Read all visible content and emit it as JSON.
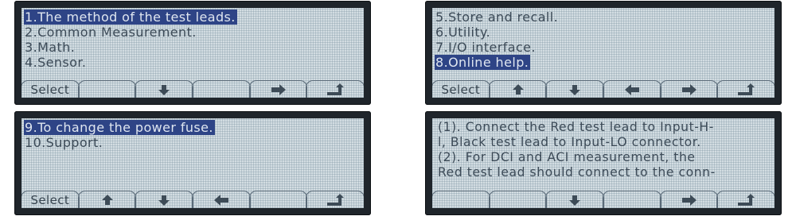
{
  "panels": [
    {
      "lines": [
        {
          "text": "1.The method of the test leads.",
          "selected": true
        },
        {
          "text": "2.Common Measurement.",
          "selected": false
        },
        {
          "text": "3.Math.",
          "selected": false
        },
        {
          "text": "4.Sensor.",
          "selected": false
        }
      ],
      "softkeys": [
        {
          "label": "Select",
          "icon": ""
        },
        {
          "label": "",
          "icon": ""
        },
        {
          "label": "",
          "icon": "down-arrow-icon"
        },
        {
          "label": "",
          "icon": ""
        },
        {
          "label": "",
          "icon": "right-arrow-icon"
        },
        {
          "label": "",
          "icon": "return-icon"
        }
      ]
    },
    {
      "lines": [
        {
          "text": "5.Store and recall.",
          "selected": false
        },
        {
          "text": "6.Utility.",
          "selected": false
        },
        {
          "text": "7.I/O interface.",
          "selected": false
        },
        {
          "text": "8.Online help.",
          "selected": true
        }
      ],
      "softkeys": [
        {
          "label": "Select",
          "icon": ""
        },
        {
          "label": "",
          "icon": "up-arrow-icon"
        },
        {
          "label": "",
          "icon": "down-arrow-icon"
        },
        {
          "label": "",
          "icon": "left-arrow-icon"
        },
        {
          "label": "",
          "icon": "right-arrow-icon"
        },
        {
          "label": "",
          "icon": "return-icon"
        }
      ]
    },
    {
      "lines": [
        {
          "text": "9.To change the power fuse.",
          "selected": true
        },
        {
          "text": "10.Support.",
          "selected": false
        }
      ],
      "softkeys": [
        {
          "label": "Select",
          "icon": ""
        },
        {
          "label": "",
          "icon": "up-arrow-icon"
        },
        {
          "label": "",
          "icon": "down-arrow-icon"
        },
        {
          "label": "",
          "icon": "left-arrow-icon"
        },
        {
          "label": "",
          "icon": ""
        },
        {
          "label": "",
          "icon": "return-icon"
        }
      ]
    },
    {
      "lines": [
        {
          "text": "(1). Connect the Red test lead to Input-H-",
          "selected": false
        },
        {
          "text": "l, Black test lead to Input-LO connector.",
          "selected": false
        },
        {
          "text": " (2). For DCI and ACI measurement, the",
          "selected": false
        },
        {
          "text": "Red test lead should connect to the conn-",
          "selected": false
        }
      ],
      "softkeys": [
        {
          "label": "",
          "icon": ""
        },
        {
          "label": "",
          "icon": ""
        },
        {
          "label": "",
          "icon": "down-arrow-icon"
        },
        {
          "label": "",
          "icon": ""
        },
        {
          "label": "",
          "icon": "right-arrow-icon"
        },
        {
          "label": "",
          "icon": "return-icon"
        }
      ]
    }
  ],
  "colors": {
    "lcd_background": "#d3dde2",
    "text": "#3c4a57",
    "highlight": "#2e4486",
    "bezel": "#1f252b"
  }
}
